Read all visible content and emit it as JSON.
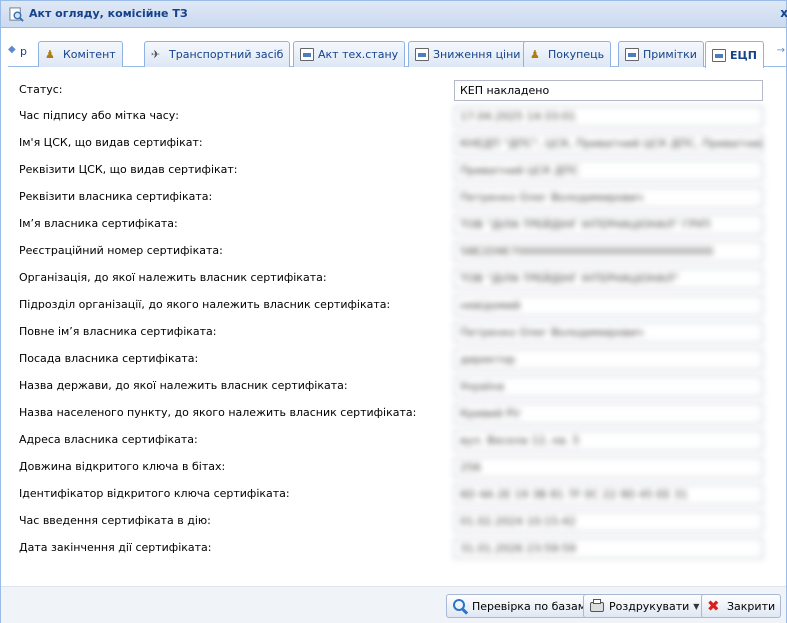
{
  "window": {
    "title": "Акт огляду, комісійне ТЗ",
    "close_glyph": "x"
  },
  "tabs": {
    "scroll_left": "◆",
    "fragment": "р",
    "scroll_right": "→",
    "items": [
      {
        "label": "Комітент",
        "icon": "people-icon"
      },
      {
        "label": "Транспортний засіб",
        "icon": "car-icon"
      },
      {
        "label": "Акт тех.стану",
        "icon": "document-icon"
      },
      {
        "label": "Зниження ціни",
        "icon": "document-icon"
      },
      {
        "label": "Покупець",
        "icon": "people-icon"
      },
      {
        "label": "Примітки",
        "icon": "document-icon"
      },
      {
        "label": "ЕЦП",
        "icon": "document-icon",
        "active": true
      }
    ]
  },
  "fields": [
    {
      "label": "Статус:",
      "value": "КЕП накладено",
      "blurred": false
    },
    {
      "label": "Час підпису або мітка часу:",
      "value": "17.04.2025 14:33:01",
      "blurred": true
    },
    {
      "label": "Ім'я ЦСК, що видав сертифікат:",
      "value": "КНЕДП \"ДПС\", ЦСК, Приватний ЦСК ДПС, Приватний ключ",
      "blurred": true
    },
    {
      "label": "Реквізити ЦСК, що видав сертифікат:",
      "value": "Приватний ЦСК ДПС",
      "blurred": true
    },
    {
      "label": "Реквізити власника сертифіката:",
      "value": "Петренко Олег Володимирович",
      "blurred": true
    },
    {
      "label": "Ім’я власника сертифіката:",
      "value": "ТОВ \"ДІЛА ТРЕЙДІНГ ІНТЕРНАЦІОНАЛ\" ГРУП",
      "blurred": true
    },
    {
      "label": "Реєстраційний номер сертифіката:",
      "value": "58E2D9E70000000000000000000000000000",
      "blurred": true
    },
    {
      "label": "Організація, до якої належить власник сертифіката:",
      "value": "ТОВ \"ДІЛА ТРЕЙДІНГ ІНТЕРНАЦІОНАЛ\"",
      "blurred": true
    },
    {
      "label": "Підрозділ організації, до якого належить власник сертифіката:",
      "value": "невідомий",
      "blurred": true
    },
    {
      "label": "Повне ім’я власника сертифіката:",
      "value": "Петренко Олег Володимирович",
      "blurred": true
    },
    {
      "label": "Посада власника сертифіката:",
      "value": "директор",
      "blurred": true
    },
    {
      "label": "Назва держави, до якої належить власник сертифіката:",
      "value": "Україна",
      "blurred": true
    },
    {
      "label": "Назва населеного пункту, до якого належить власник сертифіката:",
      "value": "Кривий Ріг",
      "blurred": true
    },
    {
      "label": "Адреса власника сертифіката:",
      "value": "вул. Весела 12, кв. 5",
      "blurred": true
    },
    {
      "label": "Довжина відкритого ключа в бітах:",
      "value": "256",
      "blurred": true
    },
    {
      "label": "Ідентифікатор відкритого ключа сертифіката:",
      "value": "6D 4A 2E 19 3B 81 7F 0C 22 9D 45 EE 31",
      "blurred": true
    },
    {
      "label": "Час введення сертифіката в дію:",
      "value": "01.02.2024 10:15:42",
      "blurred": true
    },
    {
      "label": "Дата закінчення дії сертифіката:",
      "value": "31.01.2026 23:59:59",
      "blurred": true
    }
  ],
  "footer": {
    "check_label": "Перевірка по базам",
    "print_label": "Роздрукувати",
    "close_label": "Закрити"
  },
  "colors": {
    "title_text": "#15428b",
    "border": "#99bbe8",
    "close_icon": "#d9201c"
  }
}
